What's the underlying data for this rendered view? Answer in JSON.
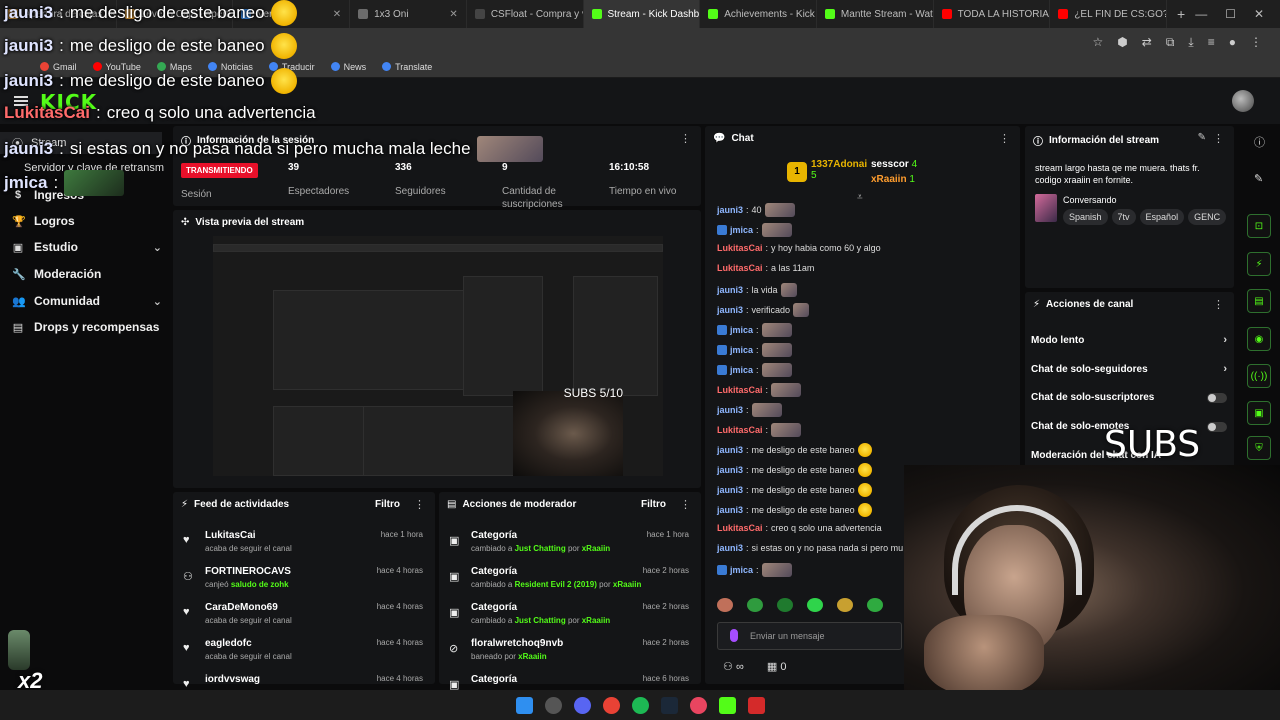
{
  "browser": {
    "tabs": [
      {
        "label": "Apertura de cajas",
        "color": "#e8a33d"
      },
      {
        "label": "Level 5 Caja - Apertu",
        "color": "#e8a33d"
      },
      {
        "label": "Ver Th",
        "color": "#3b8eea"
      },
      {
        "label": "1x3 Oni",
        "color": "#6c6c6c"
      },
      {
        "label": "CSFloat - Compra y v",
        "color": "#444"
      },
      {
        "label": "Stream - Kick Dashb",
        "color": "#53fc18",
        "active": true
      },
      {
        "label": "Achievements - Kick",
        "color": "#53fc18"
      },
      {
        "label": "Mantte Stream - Wat",
        "color": "#53fc18"
      },
      {
        "label": "TODA LA HISTORIA D",
        "color": "#ff0000"
      },
      {
        "label": "¿EL FIN DE CS:GO? -",
        "color": "#ff0000"
      }
    ],
    "bookmarks": [
      {
        "label": "Gmail",
        "color": "#ea4335"
      },
      {
        "label": "YouTube",
        "color": "#ff0000"
      },
      {
        "label": "Maps",
        "color": "#34a853"
      },
      {
        "label": "Noticias",
        "color": "#4285f4"
      },
      {
        "label": "Traducir",
        "color": "#4285f4"
      },
      {
        "label": "News",
        "color": "#4285f4"
      },
      {
        "label": "Translate",
        "color": "#4285f4"
      }
    ]
  },
  "header": {
    "logo": "KICK"
  },
  "sidebar": {
    "stream_label": "Stream",
    "sub_label": "Servidor y clave de retransm",
    "items": [
      {
        "label": "Ingresos",
        "icon": "$",
        "chevron": ""
      },
      {
        "label": "Logros",
        "icon": "🏆",
        "chevron": ""
      },
      {
        "label": "Estudio",
        "icon": "▣",
        "chevron": "⌄"
      },
      {
        "label": "Moderación",
        "icon": "🔧",
        "chevron": ""
      },
      {
        "label": "Comunidad",
        "icon": "👥",
        "chevron": "⌄"
      },
      {
        "label": "Drops y recompensas",
        "icon": "▤",
        "chevron": ""
      }
    ]
  },
  "session": {
    "title": "Información de la sesión",
    "badge": "TRANSMITIENDO",
    "stats": [
      {
        "value": "39",
        "label": "Espectadores"
      },
      {
        "value": "336",
        "label": "Seguidores"
      },
      {
        "value": "9",
        "label": "Cantidad de suscripciones"
      },
      {
        "value": "16:10:58",
        "label": "Tiempo en vivo"
      }
    ],
    "session_label": "Sesión"
  },
  "preview": {
    "title": "Vista previa del stream",
    "subs": "SUBS 5/10"
  },
  "feed": {
    "title": "Feed de actividades",
    "filter": "Filtro",
    "rows": [
      {
        "name": "LukitasCai",
        "desc": "acaba de seguir el canal",
        "hl": "",
        "time": "hace 1 hora",
        "icon": "♥"
      },
      {
        "name": "FORTINEROCAVS",
        "desc": "canjeó",
        "hl": "saludo de zohk",
        "time": "hace 4 horas",
        "icon": "⚇"
      },
      {
        "name": "CaraDeMono69",
        "desc": "acaba de seguir el canal",
        "hl": "",
        "time": "hace 4 horas",
        "icon": "♥"
      },
      {
        "name": "eagledofc",
        "desc": "acaba de seguir el canal",
        "hl": "",
        "time": "hace 4 horas",
        "icon": "♥"
      },
      {
        "name": "iordvvswag",
        "desc": "",
        "hl": "",
        "time": "hace 4 horas",
        "icon": "♥"
      }
    ]
  },
  "modactions": {
    "title": "Acciones de moderador",
    "filter": "Filtro",
    "rows": [
      {
        "name": "Categoría",
        "pre": "cambiado a",
        "hl": "Just Chatting",
        "post": "por",
        "by": "xRaaiin",
        "time": "hace 1 hora"
      },
      {
        "name": "Categoría",
        "pre": "cambiado a",
        "hl": "Resident Evil 2 (2019)",
        "post": "por",
        "by": "xRaaiin",
        "time": "hace 2 horas"
      },
      {
        "name": "Categoría",
        "pre": "cambiado a",
        "hl": "Just Chatting",
        "post": "por",
        "by": "xRaaiin",
        "time": "hace 2 horas"
      },
      {
        "name": "floralwretchoq9nvb",
        "pre": "baneado por",
        "hl": "",
        "post": "",
        "by": "xRaaiin",
        "time": "hace 2 horas"
      },
      {
        "name": "Categoría",
        "pre": "",
        "hl": "",
        "post": "",
        "by": "",
        "time": "hace 6 horas"
      }
    ]
  },
  "chat": {
    "title": "Chat",
    "leaders": [
      {
        "name": "1337Adonai",
        "count": "5"
      },
      {
        "name": "sesscor",
        "count": "4"
      },
      {
        "name": "xRaaiin",
        "count": "1"
      }
    ],
    "lines": [
      {
        "user": "jauni3",
        "cls": "u-blue",
        "text": "40",
        "emote": "w"
      },
      {
        "user": "jmica",
        "cls": "u-blue",
        "text": "",
        "emote": "w",
        "badge": true
      },
      {
        "user": "LukitasCai",
        "cls": "u-red",
        "text": "y hoy habia como 60 y algo",
        "emote": ""
      },
      {
        "user": "LukitasCai",
        "cls": "u-red",
        "text": "a las 11am",
        "emote": ""
      },
      {
        "user": "jauni3",
        "cls": "u-blue",
        "text": "la vida",
        "emote": "e"
      },
      {
        "user": "jauni3",
        "cls": "u-blue",
        "text": "verificado",
        "emote": "e"
      },
      {
        "user": "jmica",
        "cls": "u-blue",
        "text": "",
        "emote": "w",
        "badge": true
      },
      {
        "user": "jmica",
        "cls": "u-blue",
        "text": "",
        "emote": "w",
        "badge": true
      },
      {
        "user": "jmica",
        "cls": "u-blue",
        "text": "",
        "emote": "w",
        "badge": true
      },
      {
        "user": "LukitasCai",
        "cls": "u-red",
        "text": "",
        "emote": "w"
      },
      {
        "user": "jauni3",
        "cls": "u-blue",
        "text": "",
        "emote": "w"
      },
      {
        "user": "LukitasCai",
        "cls": "u-red",
        "text": "",
        "emote": "w"
      },
      {
        "user": "jauni3",
        "cls": "u-blue",
        "text": "me desligo de este baneo",
        "emote": "y"
      },
      {
        "user": "jauni3",
        "cls": "u-blue",
        "text": "me desligo de este baneo",
        "emote": "y"
      },
      {
        "user": "jauni3",
        "cls": "u-blue",
        "text": "me desligo de este baneo",
        "emote": "y"
      },
      {
        "user": "jauni3",
        "cls": "u-blue",
        "text": "me desligo de este baneo",
        "emote": "y"
      },
      {
        "user": "LukitasCai",
        "cls": "u-red",
        "text": "creo q solo una advertencia",
        "emote": ""
      },
      {
        "user": "jauni3",
        "cls": "u-blue",
        "text": "si estas on y no pasa nada si pero mu",
        "emote": ""
      },
      {
        "user": "jmica",
        "cls": "u-blue",
        "text": "",
        "emote": "w",
        "badge": true
      }
    ],
    "placeholder": "Enviar un mensaje",
    "footer_count": "0",
    "footer_infinity": "∞"
  },
  "streaminfo": {
    "title": "Información del stream",
    "desc": "stream largo hasta qe me muera. thats fr. codigo xraaiin en fornite.",
    "category": "Conversando",
    "tags": [
      "Spanish",
      "7tv",
      "Español",
      "GENC"
    ]
  },
  "actions": {
    "title": "Acciones de canal",
    "rows": [
      {
        "label": "Modo lento",
        "type": "chevron"
      },
      {
        "label": "Chat de solo-seguidores",
        "type": "chevron"
      },
      {
        "label": "Chat de solo-suscriptores",
        "type": "toggle"
      },
      {
        "label": "Chat de solo-emotes",
        "type": "toggle"
      },
      {
        "label": "Moderación del chat con IA",
        "type": "none"
      }
    ]
  },
  "overlay": {
    "lines": [
      {
        "user": "jauni3",
        "text": "me desligo de este baneo",
        "red": false
      },
      {
        "user": "jauni3",
        "text": "me desligo de este baneo",
        "red": false
      },
      {
        "user": "jauni3",
        "text": "me desligo de este baneo",
        "red": false
      },
      {
        "user": "LukitasCai",
        "text": "creo q solo una advertencia",
        "red": true
      },
      {
        "user": "jauni3",
        "text": "si estas on y no pasa nada si pero mucha mala leche",
        "red": false
      },
      {
        "user": "jmica",
        "text": "",
        "red": false
      }
    ],
    "subs": "SUBS 5/10",
    "multiplier": "x2"
  },
  "colors": {
    "brand": "#53fc18",
    "live": "#e8102a",
    "panel": "#141517"
  }
}
